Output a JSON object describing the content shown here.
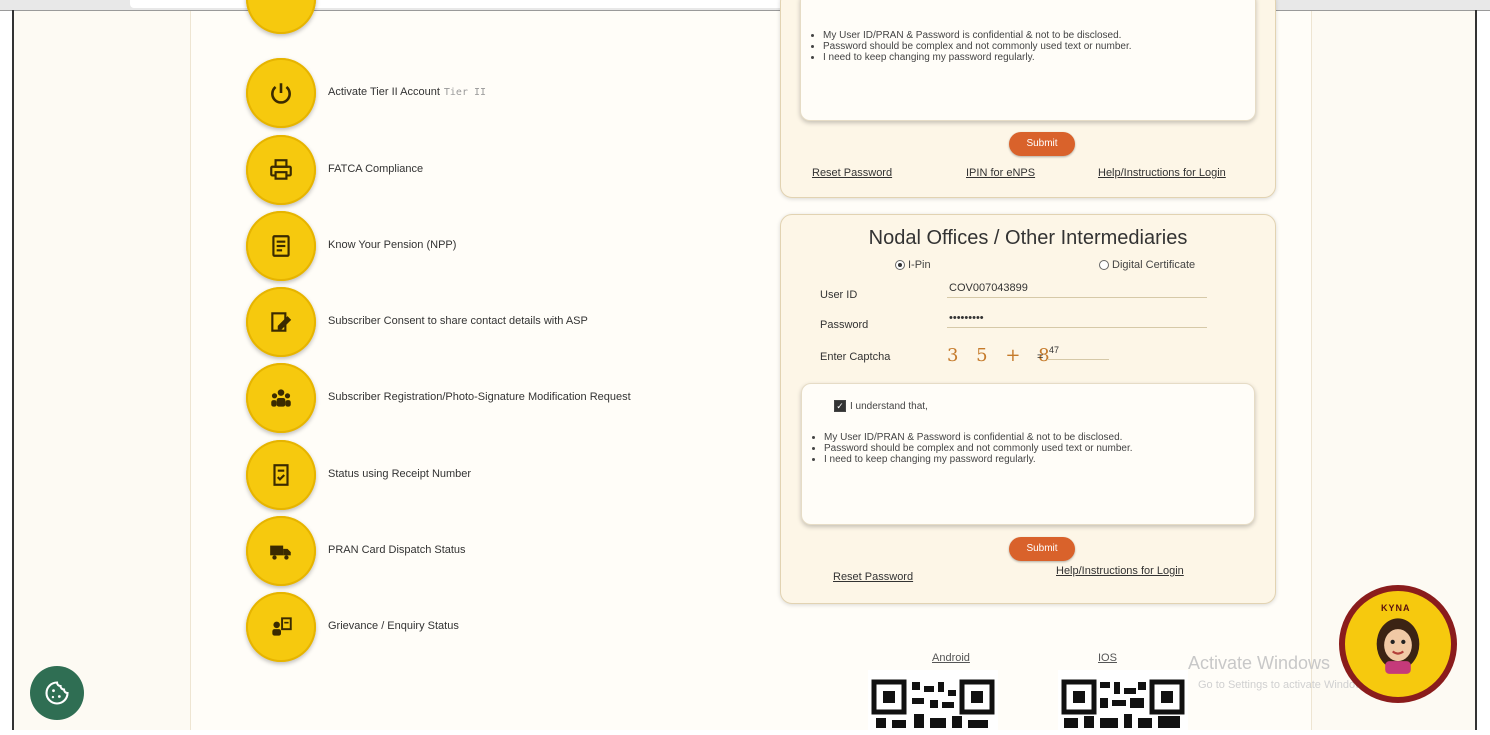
{
  "services": [
    {
      "label": "",
      "icon": "user-icon"
    },
    {
      "label": "Activate Tier II Account",
      "sub": "Tier II",
      "icon": "power-icon"
    },
    {
      "label": "FATCA Compliance",
      "icon": "printer-icon"
    },
    {
      "label": "Know Your Pension (NPP)",
      "icon": "document-icon"
    },
    {
      "label": "Subscriber Consent to share contact details with ASP",
      "icon": "consent-form-icon"
    },
    {
      "label": "Subscriber Registration/Photo-Signature Modification Request",
      "icon": "group-icon"
    },
    {
      "label": "Status using Receipt Number",
      "icon": "receipt-icon"
    },
    {
      "label": "PRAN Card Dispatch Status",
      "icon": "truck-icon"
    },
    {
      "label": "Grievance / Enquiry Status",
      "icon": "enquiry-icon"
    }
  ],
  "top_card": {
    "bullets": [
      "My User ID/PRAN & Password is confidential & not to be disclosed.",
      "Password should be complex and not commonly used text or number.",
      "I need to keep changing my password regularly."
    ],
    "submit": "Submit",
    "links": [
      "Reset Password",
      "IPIN for eNPS",
      "Help/Instructions for Login"
    ]
  },
  "nodal_card": {
    "title": "Nodal Offices / Other Intermediaries",
    "radio_ipin": "I-Pin",
    "radio_digital": "Digital Certificate",
    "user_id_label": "User ID",
    "user_id_value": "COV007043899",
    "password_label": "Password",
    "password_value": "•••••••••",
    "captcha_label": "Enter Captcha",
    "captcha_text": "3 5 + 8",
    "captcha_eq": "=",
    "captcha_answer": "47",
    "understand": "I understand that,",
    "bullets": [
      "My User ID/PRAN & Password is confidential & not to be disclosed.",
      "Password should be complex and not commonly used text or number.",
      "I need to keep changing my password regularly."
    ],
    "submit": "Submit",
    "links": [
      "Reset Password",
      "Help/Instructions for Login"
    ]
  },
  "apps": {
    "android": "Android",
    "ios": "IOS"
  },
  "watermark": {
    "title": "Activate Windows",
    "sub": "Go to Settings to activate Windows."
  },
  "kyna": {
    "tag": "KYNA"
  }
}
